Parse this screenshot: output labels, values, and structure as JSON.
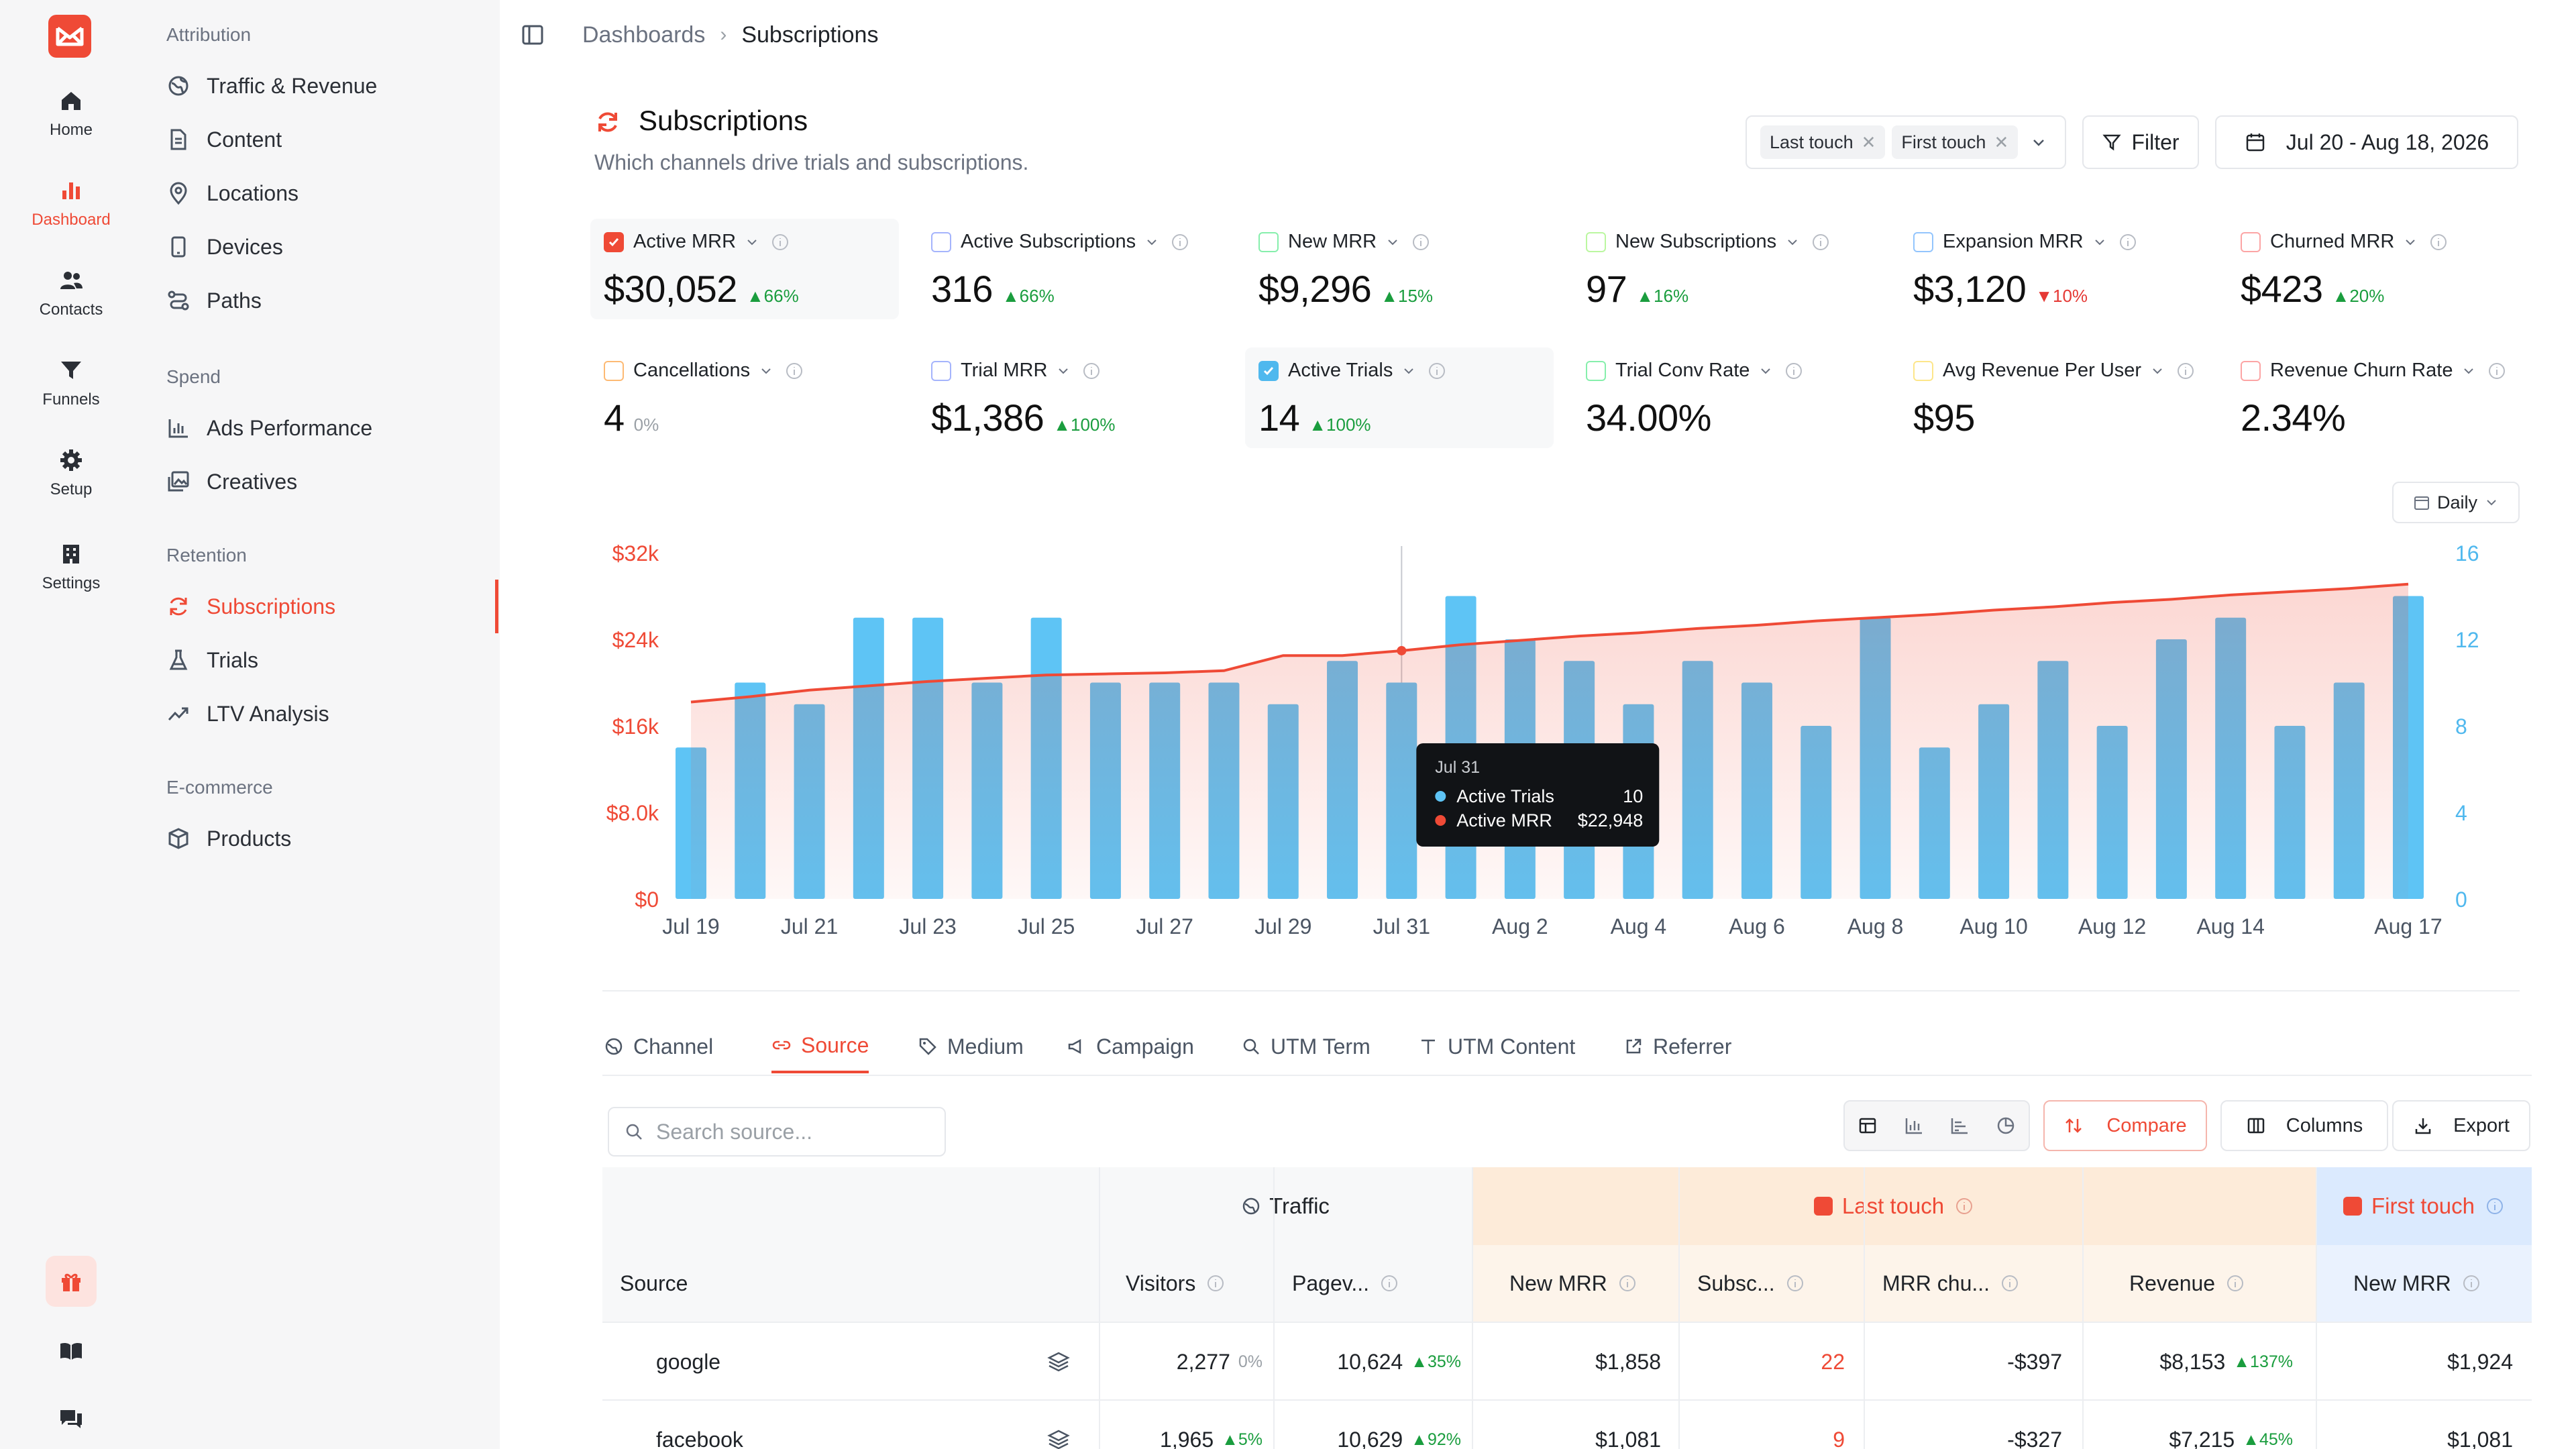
{
  "nav": {
    "items": [
      {
        "label": "Home"
      },
      {
        "label": "Dashboard"
      },
      {
        "label": "Contacts"
      },
      {
        "label": "Funnels"
      },
      {
        "label": "Setup"
      },
      {
        "label": "Settings"
      }
    ],
    "active": "Dashboard"
  },
  "sidebar": {
    "sections": [
      {
        "title": "Attribution",
        "items": [
          "Traffic & Revenue",
          "Content",
          "Locations",
          "Devices",
          "Paths"
        ]
      },
      {
        "title": "Spend",
        "items": [
          "Ads Performance",
          "Creatives"
        ]
      },
      {
        "title": "Retention",
        "items": [
          "Subscriptions",
          "Trials",
          "LTV Analysis"
        ]
      },
      {
        "title": "E-commerce",
        "items": [
          "Products"
        ]
      }
    ],
    "active": "Subscriptions"
  },
  "breadcrumb": {
    "parent": "Dashboards",
    "current": "Subscriptions"
  },
  "header": {
    "title": "Subscriptions",
    "subtitle": "Which channels drive trials and subscriptions.",
    "models": [
      "Last touch",
      "First touch"
    ],
    "filter_label": "Filter",
    "date_range": "Jul 20 - Aug 18, 2026"
  },
  "metrics": [
    {
      "label": "Active MRR",
      "value": "$30,052",
      "delta": "66%",
      "dir": "up",
      "checked": true,
      "color": "#ef4a36"
    },
    {
      "label": "Active Subscriptions",
      "value": "316",
      "delta": "66%",
      "dir": "up",
      "checked": false,
      "color": "#a5b4fc"
    },
    {
      "label": "New MRR",
      "value": "$9,296",
      "delta": "15%",
      "dir": "up",
      "checked": false,
      "color": "#86efac"
    },
    {
      "label": "New Subscriptions",
      "value": "97",
      "delta": "16%",
      "dir": "up",
      "checked": false,
      "color": "#bbf7a0"
    },
    {
      "label": "Expansion MRR",
      "value": "$3,120",
      "delta": "10%",
      "dir": "down",
      "checked": false,
      "color": "#93c5fd"
    },
    {
      "label": "Churned MRR",
      "value": "$423",
      "delta": "20%",
      "dir": "up",
      "checked": false,
      "color": "#fca5a5"
    },
    {
      "label": "Cancellations",
      "value": "4",
      "delta": "0%",
      "dir": "flat",
      "checked": false,
      "color": "#fdba74"
    },
    {
      "label": "Trial MRR",
      "value": "$1,386",
      "delta": "100%",
      "dir": "up",
      "checked": false,
      "color": "#a5b4fc"
    },
    {
      "label": "Active Trials",
      "value": "14",
      "delta": "100%",
      "dir": "up",
      "checked": true,
      "color": "#4fb8ee"
    },
    {
      "label": "Trial Conv Rate",
      "value": "34.00%",
      "delta": "",
      "dir": "none",
      "checked": false,
      "color": "#86efac"
    },
    {
      "label": "Avg Revenue Per User",
      "value": "$95",
      "delta": "",
      "dir": "none",
      "checked": false,
      "color": "#fde68a"
    },
    {
      "label": "Revenue Churn Rate",
      "value": "2.34%",
      "delta": "",
      "dir": "none",
      "checked": false,
      "color": "#fca5a5"
    }
  ],
  "granularity": "Daily",
  "chart_data": {
    "type": "bar",
    "dates": [
      "Jul 19",
      "Jul 20",
      "Jul 21",
      "Jul 22",
      "Jul 23",
      "Jul 24",
      "Jul 25",
      "Jul 26",
      "Jul 27",
      "Jul 28",
      "Jul 29",
      "Jul 30",
      "Jul 31",
      "Aug 1",
      "Aug 2",
      "Aug 3",
      "Aug 4",
      "Aug 5",
      "Aug 6",
      "Aug 7",
      "Aug 8",
      "Aug 9",
      "Aug 10",
      "Aug 11",
      "Aug 12",
      "Aug 13",
      "Aug 14",
      "Aug 15",
      "Aug 16",
      "Aug 17"
    ],
    "x_tick_labels": [
      "Jul 19",
      "Jul 21",
      "Jul 23",
      "Jul 25",
      "Jul 27",
      "Jul 29",
      "Jul 31",
      "Aug 2",
      "Aug 4",
      "Aug 6",
      "Aug 8",
      "Aug 10",
      "Aug 12",
      "Aug 14",
      "Aug 17"
    ],
    "series": [
      {
        "name": "Active Trials",
        "kind": "bar",
        "axis": "right",
        "color": "#5ec4f5",
        "values": [
          7,
          10,
          9,
          13,
          13,
          10,
          13,
          10,
          10,
          10,
          9,
          11,
          10,
          14,
          12,
          11,
          9,
          11,
          10,
          8,
          13,
          7,
          9,
          11,
          8,
          12,
          13,
          8,
          10,
          14
        ]
      },
      {
        "name": "Active MRR",
        "kind": "area-line",
        "axis": "left",
        "color": "#ef4a36",
        "values": [
          18200,
          18700,
          19300,
          19700,
          20100,
          20400,
          20700,
          20800,
          20900,
          21100,
          22500,
          22500,
          22948,
          23500,
          23900,
          24300,
          24600,
          25000,
          25300,
          25700,
          26000,
          26300,
          26700,
          27000,
          27400,
          27700,
          28100,
          28400,
          28700,
          29100
        ]
      }
    ],
    "left_axis": {
      "ticks": [
        "$0",
        "$8.0k",
        "$16k",
        "$24k",
        "$32k"
      ],
      "range": [
        0,
        32000
      ]
    },
    "right_axis": {
      "ticks": [
        "0",
        "4",
        "8",
        "12",
        "16"
      ],
      "range": [
        0,
        16
      ]
    },
    "tooltip": {
      "date": "Jul 31",
      "rows": [
        {
          "label": "Active Trials",
          "value": "10"
        },
        {
          "label": "Active MRR",
          "value": "$22,948"
        }
      ]
    },
    "hover_index": 12
  },
  "tabs": [
    "Channel",
    "Source",
    "Medium",
    "Campaign",
    "UTM Term",
    "UTM Content",
    "Referrer"
  ],
  "active_tab": "Source",
  "table_toolbar": {
    "search_placeholder": "Search source...",
    "compare": "Compare",
    "columns": "Columns",
    "export": "Export"
  },
  "table": {
    "groups": [
      "Traffic",
      "Last touch",
      "First touch"
    ],
    "columns": [
      "Source",
      "Visitors",
      "Pagev...",
      "New MRR",
      "Subsc...",
      "MRR chu...",
      "Revenue",
      "New MRR"
    ],
    "rows": [
      {
        "source": "google",
        "visitors": "2,277",
        "visitors_delta": "0%",
        "pageviews": "10,624",
        "pageviews_delta": "35%",
        "new_mrr": "$1,858",
        "subs": "22",
        "mrr_churn": "-$397",
        "revenue": "$8,153",
        "revenue_delta": "137%",
        "ft_new_mrr": "$1,924"
      },
      {
        "source": "facebook",
        "visitors": "1,965",
        "visitors_delta": "5%",
        "pageviews": "10,629",
        "pageviews_delta": "92%",
        "new_mrr": "$1,081",
        "subs": "9",
        "mrr_churn": "-$327",
        "revenue": "$7,215",
        "revenue_delta": "45%",
        "ft_new_mrr": "$1,081"
      }
    ]
  }
}
